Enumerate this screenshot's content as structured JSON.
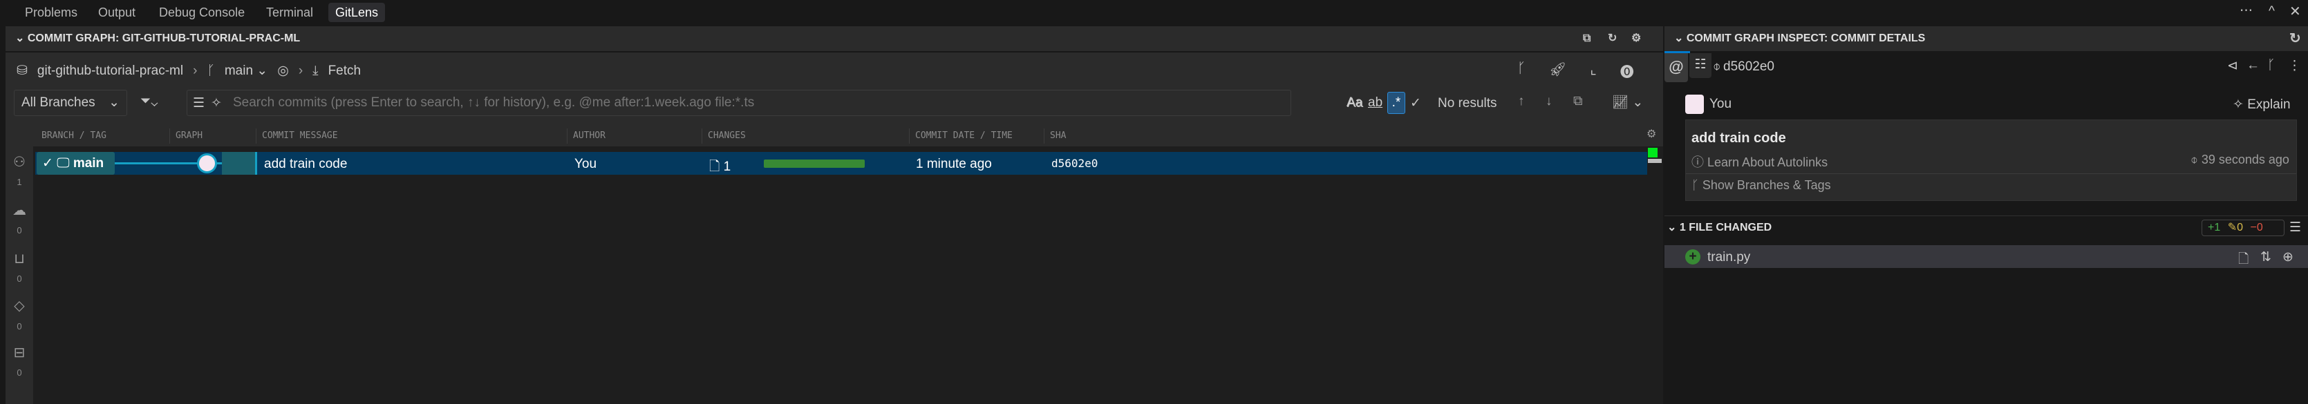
{
  "tabs": [
    {
      "label": "Problems"
    },
    {
      "label": "Output"
    },
    {
      "label": "Debug Console"
    },
    {
      "label": "Terminal"
    },
    {
      "label": "GitLens",
      "active": true
    }
  ],
  "graph_panel": {
    "title": "COMMIT GRAPH: GIT-GITHUB-TUTORIAL-PRAC-ML",
    "repo": "git-github-tutorial-prac-ml",
    "branch": "main",
    "fetch_label": "Fetch",
    "branch_filter": "All Branches",
    "search_placeholder": "Search commits (press Enter to search, ↑↓ for history), e.g. @me after:1.week.ago file:*.ts",
    "match_case": "Aa",
    "whole_word": "ab",
    "regex": ".*",
    "search_results": "No results",
    "columns": [
      "BRANCH / TAG",
      "GRAPH",
      "COMMIT MESSAGE",
      "AUTHOR",
      "CHANGES",
      "COMMIT DATE / TIME",
      "SHA"
    ],
    "rows": [
      {
        "branch": "main",
        "message": "add train code",
        "author": "You",
        "changes": "1",
        "date": "1 minute ago",
        "sha": "d5602e0"
      }
    ],
    "sidebar": [
      {
        "icon": "branches-icon",
        "count": "1"
      },
      {
        "icon": "cloud-icon",
        "count": "0"
      },
      {
        "icon": "stash-icon",
        "count": "0"
      },
      {
        "icon": "tag-icon",
        "count": "0"
      },
      {
        "icon": "worktree-icon",
        "count": "0"
      }
    ]
  },
  "details_panel": {
    "title": "COMMIT GRAPH INSPECT: COMMIT DETAILS",
    "sha": "d5602e0",
    "author": "You",
    "explain": "Explain",
    "message": "add train code",
    "autolinks": "Learn About Autolinks",
    "time": "39 seconds ago",
    "branches_tags": "Show Branches & Tags",
    "files_header": "1 FILE CHANGED",
    "stats": {
      "added": "+1",
      "modified": "0",
      "removed": "0"
    },
    "files": [
      {
        "name": "train.py",
        "status": "added"
      }
    ]
  },
  "colors": {
    "accent": "#007acc",
    "row_selected": "#04395e",
    "branch_pill": "#1b5f6b",
    "graph_line": "#15a0c4",
    "changes_bar": "#388a34",
    "added": "#388a34"
  }
}
